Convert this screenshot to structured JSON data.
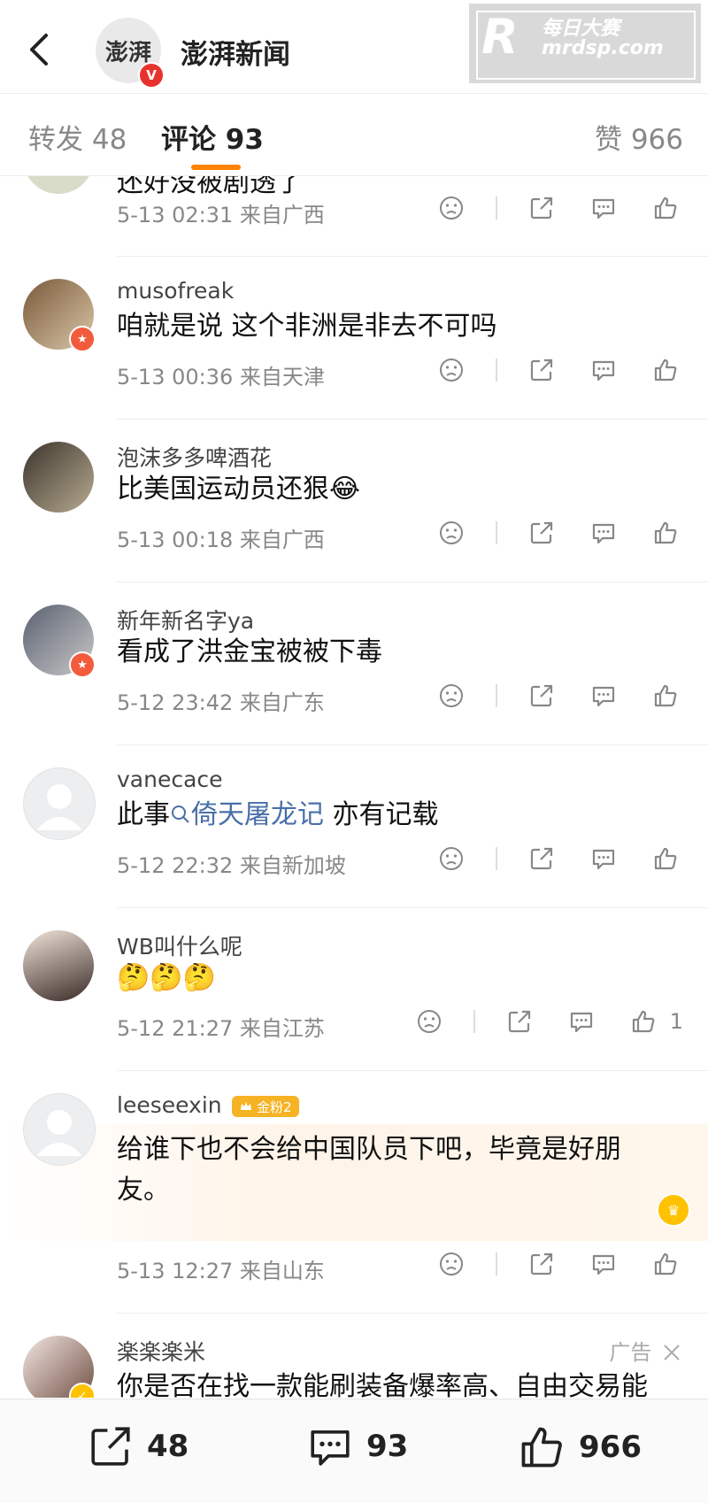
{
  "header": {
    "brand_logo_text": "澎湃",
    "verified_mark": "V",
    "brand_name": "澎湃新闻",
    "watermark": {
      "logo": "R",
      "line1": "每日大赛",
      "line2": "mrdsp.com"
    }
  },
  "tabs": [
    {
      "label": "转发 48"
    },
    {
      "label": "评论 93"
    },
    {
      "label": "赞 966"
    }
  ],
  "comments": [
    {
      "username": "",
      "text": "还好没被剧透了",
      "date": "5-13 02:31",
      "location": "来自广西",
      "likes": ""
    },
    {
      "username": "musofreak",
      "text": "咱就是说 这个非洲是非去不可吗",
      "date": "5-13 00:36",
      "location": "来自天津",
      "likes": ""
    },
    {
      "username": "泡沫多多啤酒花",
      "text": "比美国运动员还狠😂",
      "date": "5-13 00:18",
      "location": "来自广西",
      "likes": ""
    },
    {
      "username": "新年新名字ya",
      "text": "看成了洪金宝被被下毒",
      "date": "5-12 23:42",
      "location": "来自广东",
      "likes": ""
    },
    {
      "username": "vanecace",
      "text_before": "此事",
      "link": "倚天屠龙记",
      "text_after": " 亦有记载",
      "date": "5-12 22:32",
      "location": "来自新加坡",
      "likes": ""
    },
    {
      "username": "WB叫什么呢",
      "text": "🤔🤔🤔",
      "date": "5-12 21:27",
      "location": "来自江苏",
      "likes": "1"
    },
    {
      "username": "leeseexin",
      "fan_badge": "金粉2",
      "text_line1": "给谁下也不会给中国队员下吧，毕竟是好朋",
      "text_line2": "友。",
      "date": "5-13 12:27",
      "location": "来自山东",
      "likes": ""
    },
    {
      "username": "楽楽楽米",
      "ad_label": "广告",
      "text": "你是否在找一款能刷装备爆率高、自由交易能"
    }
  ],
  "bottom_bar": {
    "repost_count": "48",
    "comment_count": "93",
    "like_count": "966"
  },
  "colors": {
    "accent": "#ff8200",
    "link": "#4a6fa8",
    "badge_red": "#e8322e",
    "fan_badge": "#f5b325"
  }
}
